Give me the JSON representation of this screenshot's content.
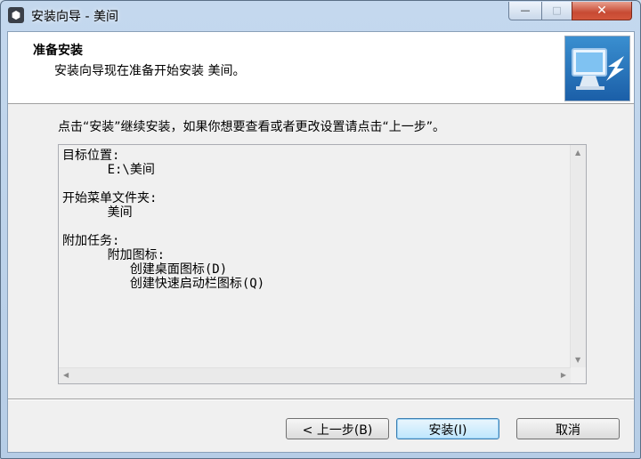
{
  "window": {
    "title": "安装向导 - 美间",
    "controls": {
      "minimize": "—",
      "maximize": "□",
      "close": "✕"
    }
  },
  "header": {
    "title": "准备安装",
    "subtitle": "安装向导现在准备开始安装 美间。"
  },
  "main": {
    "instruction": "点击“安装”继续安装，如果你想要查看或者更改设置请点击“上一步”。",
    "memo_lines": [
      "目标位置:",
      "      E:\\美间",
      "",
      "开始菜单文件夹:",
      "      美间",
      "",
      "附加任务:",
      "      附加图标:",
      "         创建桌面图标(D)",
      "         创建快速启动栏图标(Q)"
    ]
  },
  "buttons": {
    "back": "< 上一步(B)",
    "install": "安装(I)",
    "cancel": "取消"
  },
  "icons": {
    "app": "installer-icon",
    "wizard": "computer-arrow-icon"
  },
  "colors": {
    "title_gradient": "#c4d8ee",
    "close_button": "#c74a33",
    "default_button_border": "#3c7fb1"
  }
}
